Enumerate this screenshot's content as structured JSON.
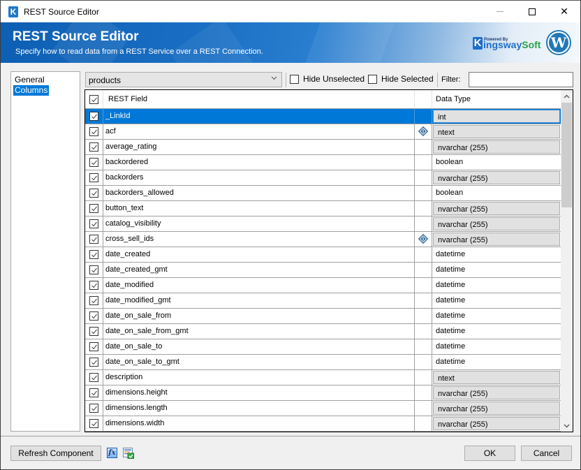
{
  "window": {
    "title": "REST Source Editor",
    "app_icon_letter": "K",
    "controls": {
      "minimize": "minimize",
      "maximize": "maximize",
      "close": "✕"
    }
  },
  "banner": {
    "title": "REST Source Editor",
    "subtitle": "Specify how to read data from a REST Service over a REST Connection.",
    "vendor_logo": {
      "powered_by": "Powered By",
      "k": "K",
      "name_part1": "ingsway",
      "name_part2": "Soft"
    },
    "service_logo_letter": "W"
  },
  "nav": {
    "items": [
      {
        "label": "General",
        "selected": false
      },
      {
        "label": "Columns",
        "selected": true
      }
    ]
  },
  "toolbar": {
    "object_select": "products",
    "hide_unselected_label": "Hide Unselected",
    "hide_unselected_checked": false,
    "hide_selected_label": "Hide Selected",
    "hide_selected_checked": false,
    "filter_label": "Filter:",
    "filter_value": ""
  },
  "grid": {
    "header": {
      "select_all_checked": true,
      "field_col": "REST Field",
      "type_col": "Data Type"
    },
    "rows": [
      {
        "field": "_LinkId",
        "checked": true,
        "info": false,
        "type": "int",
        "type_editable": true,
        "selected": true
      },
      {
        "field": "acf",
        "checked": true,
        "info": true,
        "type": "ntext",
        "type_editable": true
      },
      {
        "field": "average_rating",
        "checked": true,
        "info": false,
        "type": "nvarchar (255)",
        "type_editable": true
      },
      {
        "field": "backordered",
        "checked": true,
        "info": false,
        "type": "boolean",
        "type_editable": false
      },
      {
        "field": "backorders",
        "checked": true,
        "info": false,
        "type": "nvarchar (255)",
        "type_editable": true
      },
      {
        "field": "backorders_allowed",
        "checked": true,
        "info": false,
        "type": "boolean",
        "type_editable": false
      },
      {
        "field": "button_text",
        "checked": true,
        "info": false,
        "type": "nvarchar (255)",
        "type_editable": true
      },
      {
        "field": "catalog_visibility",
        "checked": true,
        "info": false,
        "type": "nvarchar (255)",
        "type_editable": true
      },
      {
        "field": "cross_sell_ids",
        "checked": true,
        "info": true,
        "type": "nvarchar (255)",
        "type_editable": true
      },
      {
        "field": "date_created",
        "checked": true,
        "info": false,
        "type": "datetime",
        "type_editable": false
      },
      {
        "field": "date_created_gmt",
        "checked": true,
        "info": false,
        "type": "datetime",
        "type_editable": false
      },
      {
        "field": "date_modified",
        "checked": true,
        "info": false,
        "type": "datetime",
        "type_editable": false
      },
      {
        "field": "date_modified_gmt",
        "checked": true,
        "info": false,
        "type": "datetime",
        "type_editable": false
      },
      {
        "field": "date_on_sale_from",
        "checked": true,
        "info": false,
        "type": "datetime",
        "type_editable": false
      },
      {
        "field": "date_on_sale_from_gmt",
        "checked": true,
        "info": false,
        "type": "datetime",
        "type_editable": false
      },
      {
        "field": "date_on_sale_to",
        "checked": true,
        "info": false,
        "type": "datetime",
        "type_editable": false
      },
      {
        "field": "date_on_sale_to_gmt",
        "checked": true,
        "info": false,
        "type": "datetime",
        "type_editable": false
      },
      {
        "field": "description",
        "checked": true,
        "info": false,
        "type": "ntext",
        "type_editable": true
      },
      {
        "field": "dimensions.height",
        "checked": true,
        "info": false,
        "type": "nvarchar (255)",
        "type_editable": true
      },
      {
        "field": "dimensions.length",
        "checked": true,
        "info": false,
        "type": "nvarchar (255)",
        "type_editable": true
      },
      {
        "field": "dimensions.width",
        "checked": true,
        "info": false,
        "type": "nvarchar (255)",
        "type_editable": true
      }
    ],
    "scroll_position": 0.0
  },
  "footer": {
    "refresh_label": "Refresh Component",
    "fx_icon_label": "fx",
    "ok_label": "OK",
    "cancel_label": "Cancel"
  },
  "colors": {
    "selection": "#0078d7",
    "banner_blue": "#1a6fc4",
    "kingsway_blue": "#1f6fc9",
    "kingsway_green": "#2ca34a",
    "wordpress_blue": "#2178b6"
  }
}
